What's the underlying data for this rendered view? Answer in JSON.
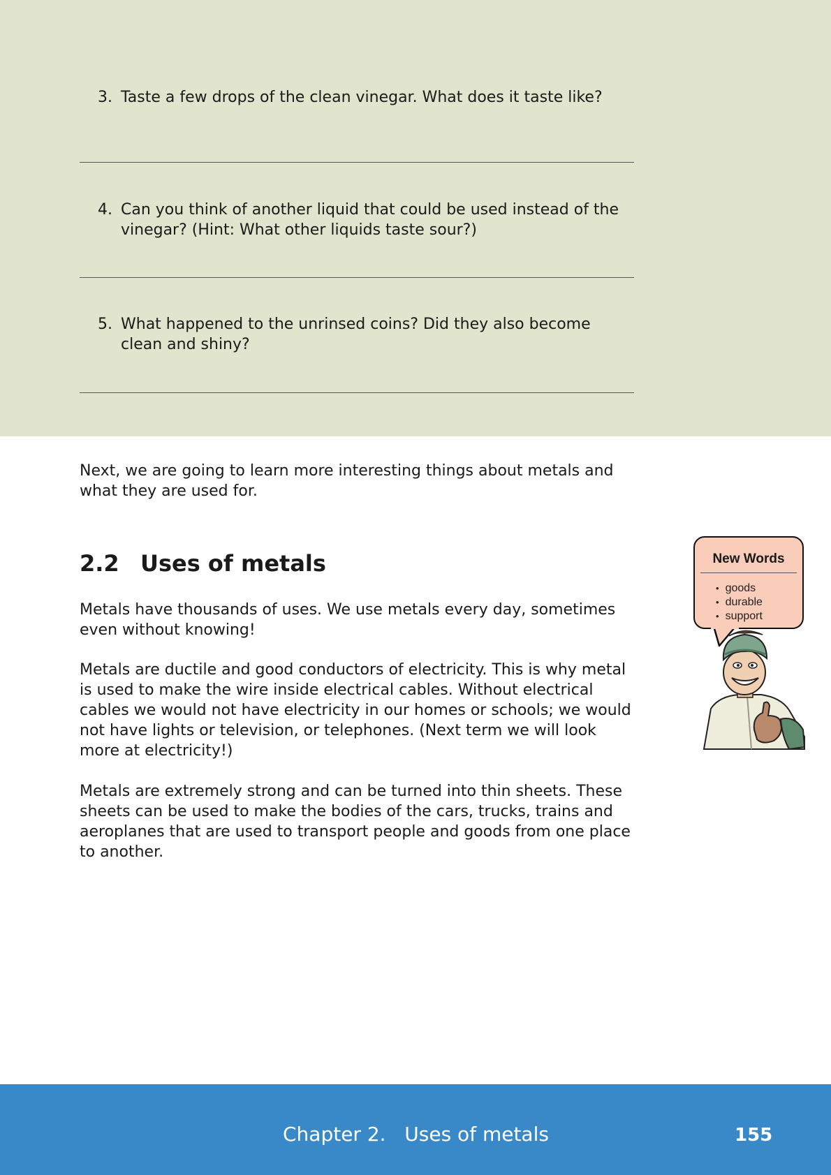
{
  "activity": {
    "questions": [
      {
        "number": "3.",
        "text": "Taste a few drops of the clean vinegar. What does it taste like?"
      },
      {
        "number": "4.",
        "text": "Can you think of another liquid that could be used instead of the vinegar? (Hint: What other liquids taste sour?)"
      },
      {
        "number": "5.",
        "text": "What happened to the unrinsed coins? Did they also become clean and shiny?"
      }
    ]
  },
  "intro": "Next, we are going to learn more interesting things about metals and what they are used for.",
  "section": {
    "number": "2.2",
    "title": "Uses of metals",
    "paragraphs": [
      "Metals have thousands of uses. We use metals every day, sometimes even without knowing!",
      "Metals are ductile and good conductors of electricity. This is why metal is used to make the wire inside electrical cables. Without electrical cables we would not have electricity in our homes or schools; we would not have lights or television, or telephones. (Next term we will look more at electricity!)",
      "Metals are extremely strong and can be turned into thin sheets. These sheets can be used to make the bodies of the cars, trucks, trains and aeroplanes that are used to transport people and goods from one place to another."
    ]
  },
  "new_words": {
    "title": "New Words",
    "items": [
      "goods",
      "durable",
      "support"
    ]
  },
  "footer": {
    "chapter_title": "Chapter 2.   Uses of metals",
    "page_number": "155"
  },
  "colors": {
    "activity_background": "#e1e5cd",
    "footer_background": "#3989c9",
    "new_words_background": "#f9cdb9"
  }
}
